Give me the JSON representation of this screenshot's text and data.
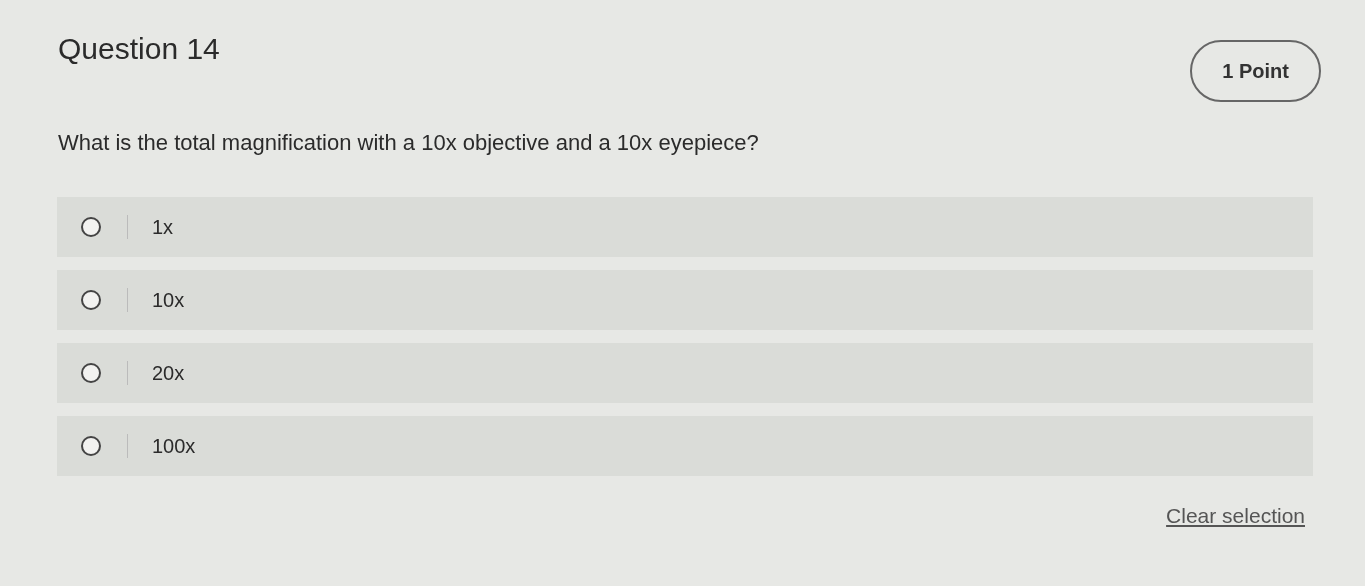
{
  "question": {
    "title": "Question 14",
    "points": "1 Point",
    "prompt": "What is the total magnification with a 10x objective and a 10x eyepiece?"
  },
  "options": [
    {
      "label": "1x",
      "selected": false
    },
    {
      "label": "10x",
      "selected": false
    },
    {
      "label": "20x",
      "selected": false
    },
    {
      "label": "100x",
      "selected": false
    }
  ],
  "clear_link": "Clear selection"
}
